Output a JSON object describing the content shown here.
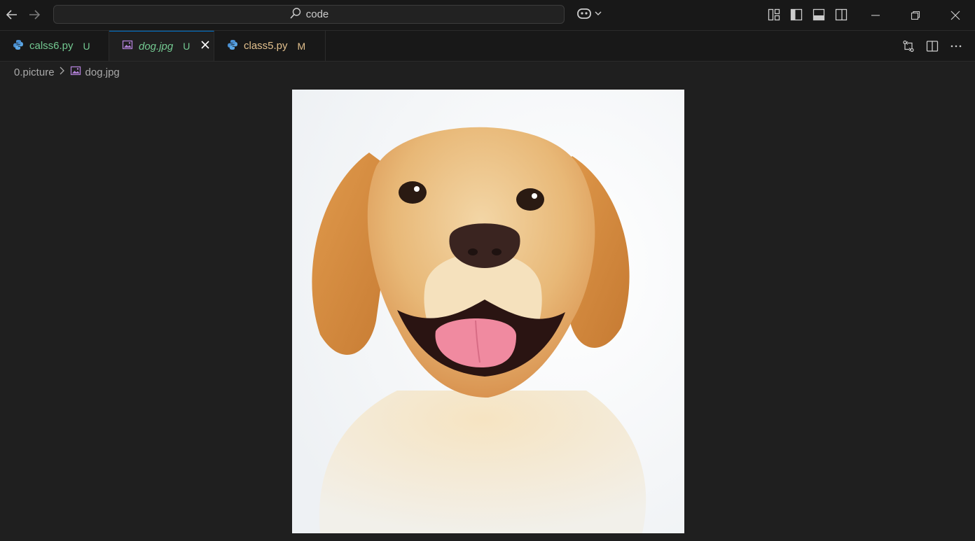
{
  "titlebar": {
    "search_text": "code"
  },
  "tabs": [
    {
      "label": "calss6.py",
      "badge": "U",
      "icon": "python-icon"
    },
    {
      "label": "dog.jpg",
      "badge": "U",
      "icon": "image-file-icon",
      "active": true
    },
    {
      "label": "class5.py",
      "badge": "M",
      "icon": "python-icon"
    }
  ],
  "breadcrumb": {
    "folder": "0.picture",
    "file": "dog.jpg"
  },
  "image": {
    "subject": "golden retriever puppy smiling",
    "accent_colors": [
      "#e0a25c",
      "#f5f7f9"
    ]
  },
  "colors": {
    "active_tab_border": "#0078d4",
    "untracked": "#73c991",
    "modified": "#e2c08d"
  }
}
